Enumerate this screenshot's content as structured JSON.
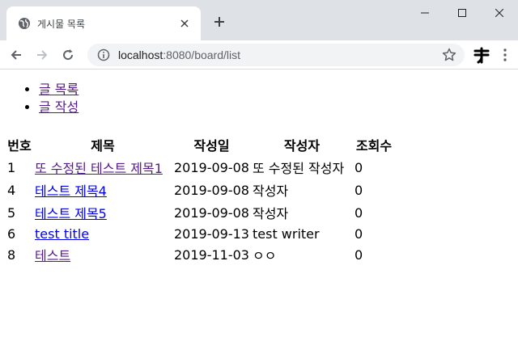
{
  "browser": {
    "tab_title": "게시물 목록",
    "url_host": "localhost",
    "url_rest": ":8080/board/list"
  },
  "nav": {
    "items": [
      {
        "label": "글 목록"
      },
      {
        "label": "글 작성"
      }
    ]
  },
  "board": {
    "headers": [
      "번호",
      "제목",
      "작성일",
      "작성자",
      "조회수"
    ],
    "rows": [
      {
        "no": "1",
        "title": "또 수정된 테스트 제목1",
        "date": "2019-09-08",
        "writer": "또 수정된 작성자",
        "views": "0",
        "visited": true
      },
      {
        "no": "4",
        "title": "테스트 제목4",
        "date": "2019-09-08",
        "writer": "작성자",
        "views": "0",
        "visited": false
      },
      {
        "no": "5",
        "title": "테스트 제목5",
        "date": "2019-09-08",
        "writer": "작성자",
        "views": "0",
        "visited": false
      },
      {
        "no": "6",
        "title": "test title",
        "date": "2019-09-13",
        "writer": "test writer",
        "views": "0",
        "visited": false
      },
      {
        "no": "8",
        "title": "테스트",
        "date": "2019-11-03",
        "writer": "ㅇㅇ",
        "views": "0",
        "visited": true
      }
    ]
  },
  "colors": {
    "link": "#0000ee",
    "visited_link": "#551a8b",
    "tabstrip": "#dee1e6"
  }
}
